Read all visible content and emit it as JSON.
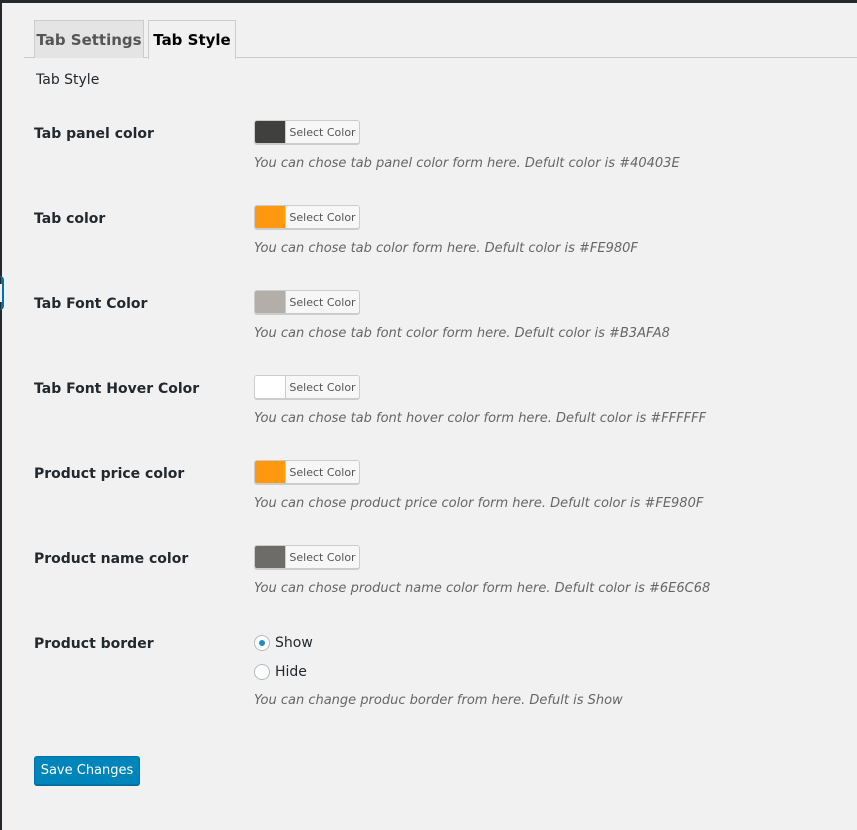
{
  "tabs": [
    {
      "label": "Tab Settings",
      "active": false
    },
    {
      "label": "Tab Style",
      "active": true
    }
  ],
  "section_title": "Tab Style",
  "picker_label": "Select Color",
  "rows": [
    {
      "label": "Tab panel color",
      "color": "#40403E",
      "desc": "You can chose tab panel color form here. Defult color is #40403E"
    },
    {
      "label": "Tab color",
      "color": "#FE980F",
      "desc": "You can chose tab color form here. Defult color is #FE980F"
    },
    {
      "label": "Tab Font Color",
      "color": "#B3AFA8",
      "desc": "You can chose tab font color form here. Defult color is #B3AFA8"
    },
    {
      "label": "Tab Font Hover Color",
      "color": "#FFFFFF",
      "desc": "You can chose tab font hover color form here. Defult color is #FFFFFF"
    },
    {
      "label": "Product price color",
      "color": "#FE980F",
      "desc": "You can chose product price color form here. Defult color is #FE980F"
    },
    {
      "label": "Product name color",
      "color": "#6E6C68",
      "desc": "You can chose product name color form here. Defult color is #6E6C68"
    }
  ],
  "border": {
    "label": "Product border",
    "options": [
      {
        "label": "Show",
        "checked": true
      },
      {
        "label": "Hide",
        "checked": false
      }
    ],
    "desc": "You can change produc border from here. Defult is Show"
  },
  "save_label": "Save Changes",
  "colors": {
    "accent": "#0085ba",
    "radio_dot": "#1e8cbe"
  }
}
